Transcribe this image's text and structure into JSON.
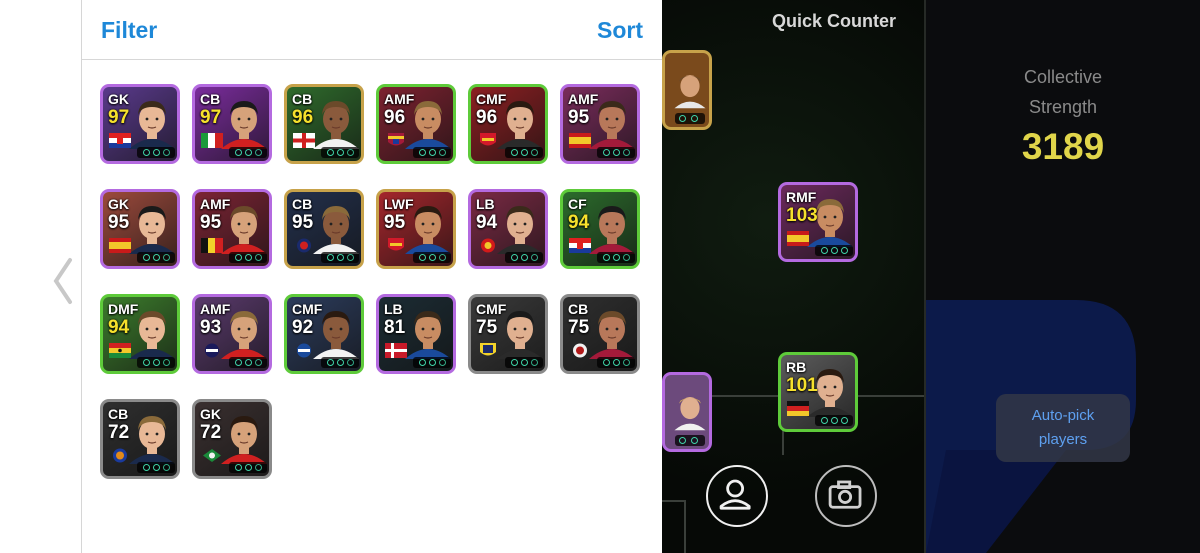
{
  "header": {
    "filter_label": "Filter",
    "sort_label": "Sort"
  },
  "cards": [
    {
      "pos": "GK",
      "ovr": "97",
      "gold": true,
      "frame": "#b46ae0",
      "bg": "#5a3a8c",
      "flag": "croatia"
    },
    {
      "pos": "CB",
      "ovr": "97",
      "gold": true,
      "frame": "#b46ae0",
      "bg": "#7a2c9c",
      "flag": "italy"
    },
    {
      "pos": "CB",
      "ovr": "96",
      "gold": true,
      "frame": "#c7a24a",
      "bg": "#2f6b2c",
      "flag": "england"
    },
    {
      "pos": "AMF",
      "ovr": "96",
      "gold": false,
      "frame": "#5ecb3a",
      "bg": "#7d2230",
      "flag": "barcelona"
    },
    {
      "pos": "CMF",
      "ovr": "96",
      "gold": false,
      "frame": "#5ecb3a",
      "bg": "#8c1f22",
      "flag": "arsenal"
    },
    {
      "pos": "AMF",
      "ovr": "95",
      "gold": false,
      "frame": "#b46ae0",
      "bg": "#7a2c5c",
      "flag": "spain"
    },
    {
      "pos": "GK",
      "ovr": "95",
      "gold": false,
      "frame": "#b46ae0",
      "bg": "#9c4a3c",
      "flag": "spain"
    },
    {
      "pos": "AMF",
      "ovr": "95",
      "gold": false,
      "frame": "#b46ae0",
      "bg": "#7c2434",
      "flag": "belgium"
    },
    {
      "pos": "CB",
      "ovr": "95",
      "gold": false,
      "frame": "#c7a24a",
      "bg": "#23304c",
      "flag": "psg"
    },
    {
      "pos": "LWF",
      "ovr": "95",
      "gold": false,
      "frame": "#c7a24a",
      "bg": "#a4262c",
      "flag": "arsenal"
    },
    {
      "pos": "LB",
      "ovr": "94",
      "gold": false,
      "frame": "#b46ae0",
      "bg": "#7a2a44",
      "flag": "manutd"
    },
    {
      "pos": "CF",
      "ovr": "94",
      "gold": true,
      "frame": "#5ecb3a",
      "bg": "#2c6c2c",
      "flag": "croatia"
    },
    {
      "pos": "DMF",
      "ovr": "94",
      "gold": true,
      "frame": "#5ecb3a",
      "bg": "#3c7c2c",
      "flag": "ghana"
    },
    {
      "pos": "AMF",
      "ovr": "93",
      "gold": false,
      "frame": "#b46ae0",
      "bg": "#5a3a6c",
      "flag": "inter"
    },
    {
      "pos": "CMF",
      "ovr": "92",
      "gold": false,
      "frame": "#5ecb3a",
      "bg": "#2c3c5c",
      "flag": "club"
    },
    {
      "pos": "LB",
      "ovr": "81",
      "gold": false,
      "frame": "#b46ae0",
      "bg": "#1c2c34",
      "flag": "denmark"
    },
    {
      "pos": "CMF",
      "ovr": "75",
      "gold": false,
      "frame": "#8a8a8a",
      "bg": "#3a3a3a",
      "flag": "parma"
    },
    {
      "pos": "CB",
      "ovr": "75",
      "gold": false,
      "frame": "#8a8a8a",
      "bg": "#2f2f2f",
      "flag": "club2"
    },
    {
      "pos": "CB",
      "ovr": "72",
      "gold": false,
      "frame": "#8a8a8a",
      "bg": "#2f2f2f",
      "flag": "club3"
    },
    {
      "pos": "GK",
      "ovr": "72",
      "gold": false,
      "frame": "#8a8a8a",
      "bg": "#3a3030",
      "flag": "club4"
    }
  ],
  "game": {
    "quick_counter": "Quick Counter",
    "collective_strength_line1": "Collective",
    "collective_strength_line2": "Strength",
    "collective_strength_value": "3189",
    "autopick_line1": "Auto-pick",
    "autopick_line2": "players",
    "field_cards": [
      {
        "pos": "RMF",
        "ovr": "103",
        "frame": "#b46ae0",
        "bg": "#6c2a5c",
        "flag": "spain"
      },
      {
        "pos": "RB",
        "ovr": "101",
        "frame": "#5ecb3a",
        "bg": "#5c5c5c",
        "flag": "germany"
      }
    ]
  },
  "icons": {
    "back": "chevron-left-icon",
    "profile": "person-icon",
    "camera": "camera-icon"
  }
}
